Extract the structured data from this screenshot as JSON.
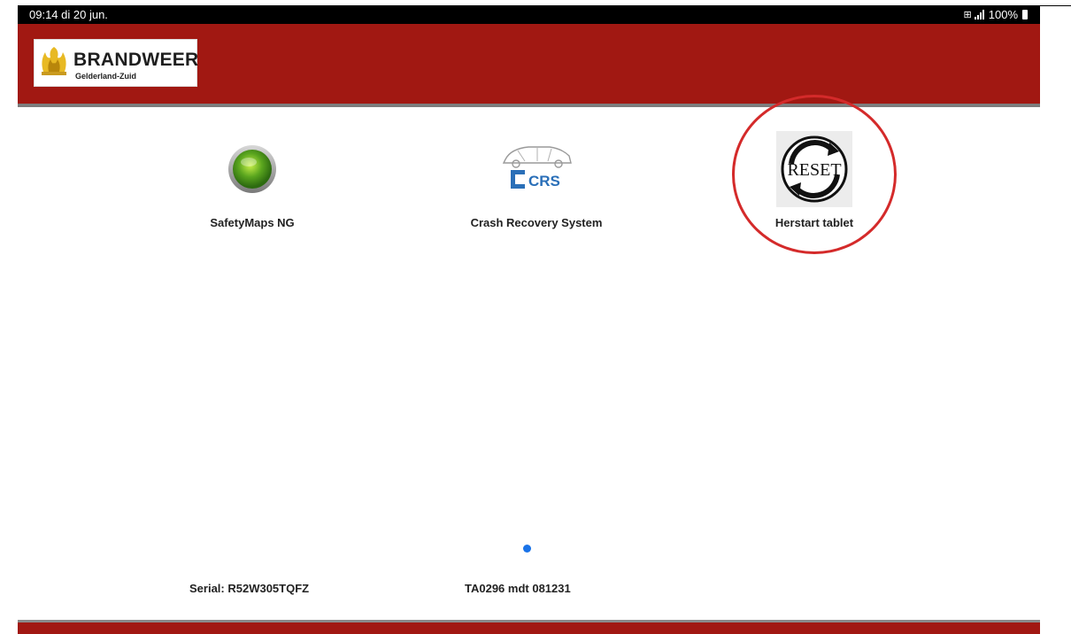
{
  "statusbar": {
    "time": "09:14  di 20 jun.",
    "battery": "100%",
    "icons": [
      "sim-icon",
      "signal-icon",
      "battery-icon"
    ]
  },
  "header": {
    "logo_title": "BRANDWEER",
    "logo_subtitle": "Gelderland-Zuid",
    "background_color": "#a11812"
  },
  "apps": [
    {
      "label": "SafetyMaps NG",
      "icon": "green-globe-icon"
    },
    {
      "label": "Crash Recovery System",
      "icon": "crs-car-icon",
      "icon_text": "CRS"
    },
    {
      "label": "Herstart tablet",
      "icon": "reset-icon",
      "icon_text": "RESET",
      "highlighted": true
    }
  ],
  "pager": {
    "active_page": 1,
    "color": "#1a73e8"
  },
  "footer": {
    "serial": "Serial: R52W305TQFZ",
    "device_id": "TA0296 mdt 081231"
  }
}
